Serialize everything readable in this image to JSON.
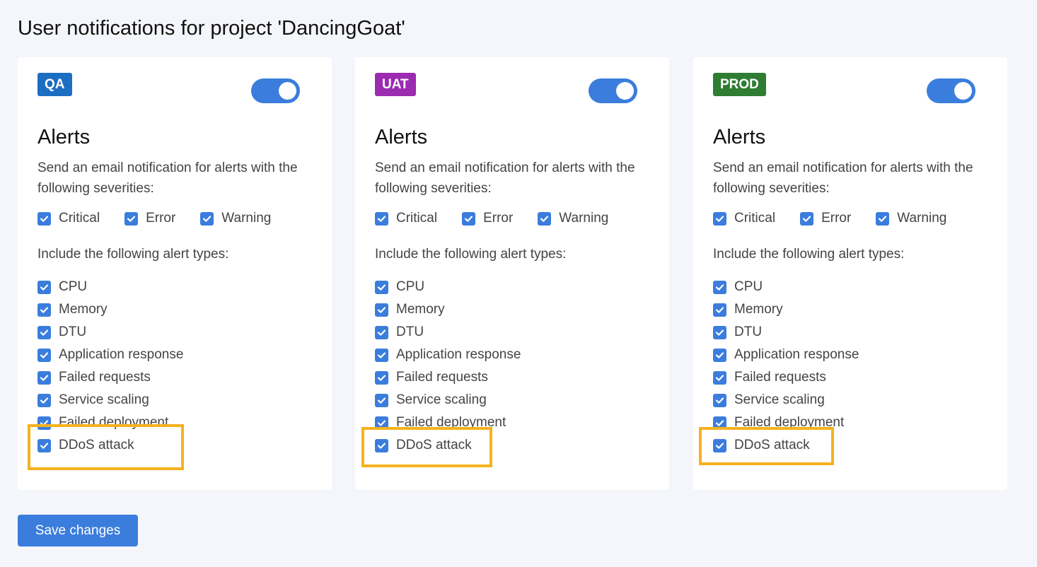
{
  "page": {
    "title": "User notifications for project 'DancingGoat'"
  },
  "environments": [
    {
      "badge": "QA",
      "badge_color": "#1c6ec2",
      "enabled": true,
      "section_title": "Alerts",
      "description": "Send an email notification for alerts with the following severities:",
      "severities": [
        {
          "label": "Critical",
          "checked": true
        },
        {
          "label": "Error",
          "checked": true
        },
        {
          "label": "Warning",
          "checked": true
        }
      ],
      "types_heading": "Include the following alert types:",
      "alert_types": [
        {
          "label": "CPU",
          "checked": true
        },
        {
          "label": "Memory",
          "checked": true
        },
        {
          "label": "DTU",
          "checked": true
        },
        {
          "label": "Application response",
          "checked": true
        },
        {
          "label": "Failed requests",
          "checked": true
        },
        {
          "label": "Service scaling",
          "checked": true
        },
        {
          "label": "Failed deployment",
          "checked": true
        },
        {
          "label": "DDoS attack",
          "checked": true
        }
      ]
    },
    {
      "badge": "UAT",
      "badge_color": "#9b2bb0",
      "enabled": true,
      "section_title": "Alerts",
      "description": "Send an email notification for alerts with the following severities:",
      "severities": [
        {
          "label": "Critical",
          "checked": true
        },
        {
          "label": "Error",
          "checked": true
        },
        {
          "label": "Warning",
          "checked": true
        }
      ],
      "types_heading": "Include the following alert types:",
      "alert_types": [
        {
          "label": "CPU",
          "checked": true
        },
        {
          "label": "Memory",
          "checked": true
        },
        {
          "label": "DTU",
          "checked": true
        },
        {
          "label": "Application response",
          "checked": true
        },
        {
          "label": "Failed requests",
          "checked": true
        },
        {
          "label": "Service scaling",
          "checked": true
        },
        {
          "label": "Failed deployment",
          "checked": true
        },
        {
          "label": "DDoS attack",
          "checked": true
        }
      ]
    },
    {
      "badge": "PROD",
      "badge_color": "#2e7d32",
      "enabled": true,
      "section_title": "Alerts",
      "description": "Send an email notification for alerts with the following severities:",
      "severities": [
        {
          "label": "Critical",
          "checked": true
        },
        {
          "label": "Error",
          "checked": true
        },
        {
          "label": "Warning",
          "checked": true
        }
      ],
      "types_heading": "Include the following alert types:",
      "alert_types": [
        {
          "label": "CPU",
          "checked": true
        },
        {
          "label": "Memory",
          "checked": true
        },
        {
          "label": "DTU",
          "checked": true
        },
        {
          "label": "Application response",
          "checked": true
        },
        {
          "label": "Failed requests",
          "checked": true
        },
        {
          "label": "Service scaling",
          "checked": true
        },
        {
          "label": "Failed deployment",
          "checked": true
        },
        {
          "label": "DDoS attack",
          "checked": true
        }
      ]
    }
  ],
  "theme": {
    "accent": "#3b7ddd",
    "highlight": "#f5b21e"
  },
  "actions": {
    "save_label": "Save changes"
  }
}
